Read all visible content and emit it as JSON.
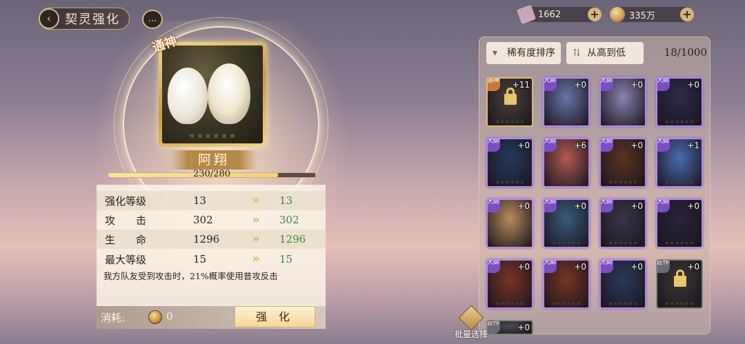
{
  "header": {
    "back_symbol": "‹",
    "title": "契灵强化",
    "chat_symbol": "…"
  },
  "resources": [
    {
      "icon": "ticket-icon",
      "value": "1662",
      "color": "#c9a7b8"
    },
    {
      "icon": "coin-icon",
      "value": "335万",
      "color": "#d4aa5a"
    }
  ],
  "spirit": {
    "rank_badge": "通神",
    "name": "阿翔",
    "exp_current": 230,
    "exp_max": 280,
    "exp_text": "230/280"
  },
  "stats": [
    {
      "label": "强化等级",
      "current": "13",
      "next": "13"
    },
    {
      "label": "攻　　击",
      "current": "302",
      "next": "302"
    },
    {
      "label": "生　　命",
      "current": "1296",
      "next": "1296"
    },
    {
      "label": "最大等级",
      "current": "15",
      "next": "15"
    }
  ],
  "description": "我方队友受到攻击时，21%概率使用普攻反击",
  "cost": {
    "label": "消耗:",
    "value": "0"
  },
  "upgrade_label": "强 化",
  "sort": {
    "rarity_label": "稀有度排序",
    "order_label": "从高到低",
    "count": "18/1000"
  },
  "grid": [
    {
      "tag": "通神",
      "plus": "+11",
      "locked": true,
      "frame": "gold",
      "bg": "#4a4038"
    },
    {
      "tag": "大師",
      "plus": "+0",
      "locked": false,
      "frame": "purple",
      "bg": "#6a74a8"
    },
    {
      "tag": "大師",
      "plus": "+0",
      "locked": false,
      "frame": "purple",
      "bg": "#8a82b0"
    },
    {
      "tag": "大師",
      "plus": "+0",
      "locked": false,
      "frame": "purple",
      "bg": "#2e2a48"
    },
    {
      "tag": "大師",
      "plus": "+0",
      "locked": false,
      "frame": "purple",
      "bg": "#243a5c"
    },
    {
      "tag": "大師",
      "plus": "+6",
      "locked": false,
      "frame": "purple",
      "bg": "#b25a52"
    },
    {
      "tag": "大師",
      "plus": "+0",
      "locked": false,
      "frame": "purple",
      "bg": "#5a3420"
    },
    {
      "tag": "大師",
      "plus": "+1",
      "locked": false,
      "frame": "purple",
      "bg": "#4a6ab0"
    },
    {
      "tag": "大師",
      "plus": "+0",
      "locked": false,
      "frame": "purple",
      "bg": "#b88a5a"
    },
    {
      "tag": "大師",
      "plus": "+0",
      "locked": false,
      "frame": "purple",
      "bg": "#3a5a7a"
    },
    {
      "tag": "大師",
      "plus": "+0",
      "locked": false,
      "frame": "purple",
      "bg": "#3a3448"
    },
    {
      "tag": "大師",
      "plus": "+0",
      "locked": false,
      "frame": "purple",
      "bg": "#2a2438"
    },
    {
      "tag": "大師",
      "plus": "+0",
      "locked": false,
      "frame": "purple",
      "bg": "#7a3424"
    },
    {
      "tag": "大師",
      "plus": "+0",
      "locked": false,
      "frame": "purple",
      "bg": "#7a3424"
    },
    {
      "tag": "大師",
      "plus": "+0",
      "locked": false,
      "frame": "purple",
      "bg": "#2a3a5a"
    },
    {
      "tag": "匠作",
      "plus": "+0",
      "locked": true,
      "frame": "grey",
      "bg": "#3a3634"
    },
    {
      "tag": "匠作",
      "plus": "+0",
      "locked": false,
      "frame": "grey",
      "bg": "#4a4a50"
    }
  ],
  "batch_label": "批量选择",
  "colors": {
    "accent": "#d8b878",
    "gain_green": "#3d8a3a",
    "rare_purple": "#b58be6"
  }
}
